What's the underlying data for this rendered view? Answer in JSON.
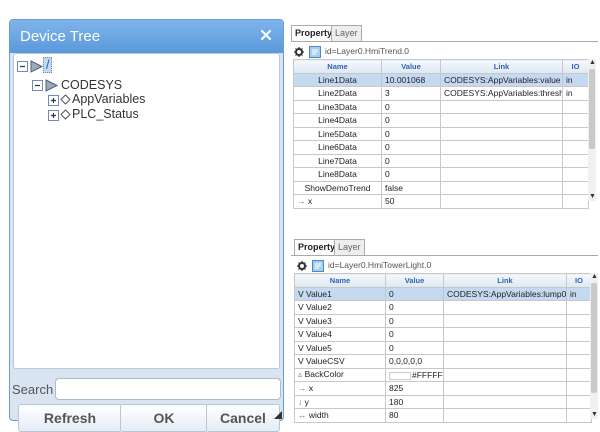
{
  "device_tree": {
    "title": "Device Tree",
    "close_icon": "close-icon",
    "nodes": [
      {
        "label": "/",
        "icon": "device-icon",
        "expander": "collapse-icon"
      },
      {
        "label": "CODESYS",
        "icon": "device-icon",
        "expander": "collapse-icon"
      },
      {
        "label": "AppVariables",
        "icon": "variable-icon",
        "expander": "expand-icon"
      },
      {
        "label": "PLC_Status",
        "icon": "variable-icon",
        "expander": "expand-icon"
      }
    ],
    "search_label": "Search",
    "search_value": "",
    "buttons": {
      "refresh": "Refresh",
      "ok": "OK",
      "cancel": "Cancel"
    },
    "colors": {
      "header": "#5a99dc",
      "body": "#d9e4f0"
    }
  },
  "trend_panel": {
    "tabs": [
      "Property",
      "Layer"
    ],
    "active_tab": "Property",
    "id_text": "id=Layer0.HmiTrend.0",
    "columns": [
      "Name",
      "Value",
      "Link",
      "IO"
    ],
    "rows": [
      {
        "name": "Line1Data",
        "value": "10.001068",
        "link": "CODESYS:AppVariables:value",
        "io": "in"
      },
      {
        "name": "Line2Data",
        "value": "3",
        "link": "CODESYS:AppVariables:threshold",
        "io": "in"
      },
      {
        "name": "Line3Data",
        "value": "0",
        "link": "",
        "io": ""
      },
      {
        "name": "Line4Data",
        "value": "0",
        "link": "",
        "io": ""
      },
      {
        "name": "Line5Data",
        "value": "0",
        "link": "",
        "io": ""
      },
      {
        "name": "Line6Data",
        "value": "0",
        "link": "",
        "io": ""
      },
      {
        "name": "Line7Data",
        "value": "0",
        "link": "",
        "io": ""
      },
      {
        "name": "Line8Data",
        "value": "0",
        "link": "",
        "io": ""
      },
      {
        "name": "ShowDemoTrend",
        "value": "false",
        "link": "",
        "io": ""
      },
      {
        "name": "x",
        "value": "50",
        "link": "",
        "io": "",
        "prefix": "→ "
      }
    ]
  },
  "tower_panel": {
    "tabs": [
      "Property",
      "Layer"
    ],
    "active_tab": "Property",
    "id_text": "id=Layer0.HmiTowerLight.0",
    "columns": [
      "Name",
      "Value",
      "Link",
      "IO"
    ],
    "rows": [
      {
        "name": "Value1",
        "value": "0",
        "link": "CODESYS:AppVariables:lump0",
        "io": "in",
        "prefix": "V  "
      },
      {
        "name": "Value2",
        "value": "0",
        "link": "",
        "io": "",
        "prefix": "V  "
      },
      {
        "name": "Value3",
        "value": "0",
        "link": "",
        "io": "",
        "prefix": "V  "
      },
      {
        "name": "Value4",
        "value": "0",
        "link": "",
        "io": "",
        "prefix": "V  "
      },
      {
        "name": "Value5",
        "value": "0",
        "link": "",
        "io": "",
        "prefix": "V  "
      },
      {
        "name": "ValueCSV",
        "value": "0,0,0,0,0",
        "link": "",
        "io": "",
        "prefix": "V  "
      },
      {
        "name": "BackColor",
        "value": "#FFFFFF",
        "link": "",
        "io": "",
        "prefix": "▵ "
      },
      {
        "name": "x",
        "value": "825",
        "link": "",
        "io": "",
        "prefix": "→ "
      },
      {
        "name": "y",
        "value": "180",
        "link": "",
        "io": "",
        "prefix": "↓ "
      },
      {
        "name": "width",
        "value": "80",
        "link": "",
        "io": "",
        "prefix": "↔ "
      }
    ]
  }
}
